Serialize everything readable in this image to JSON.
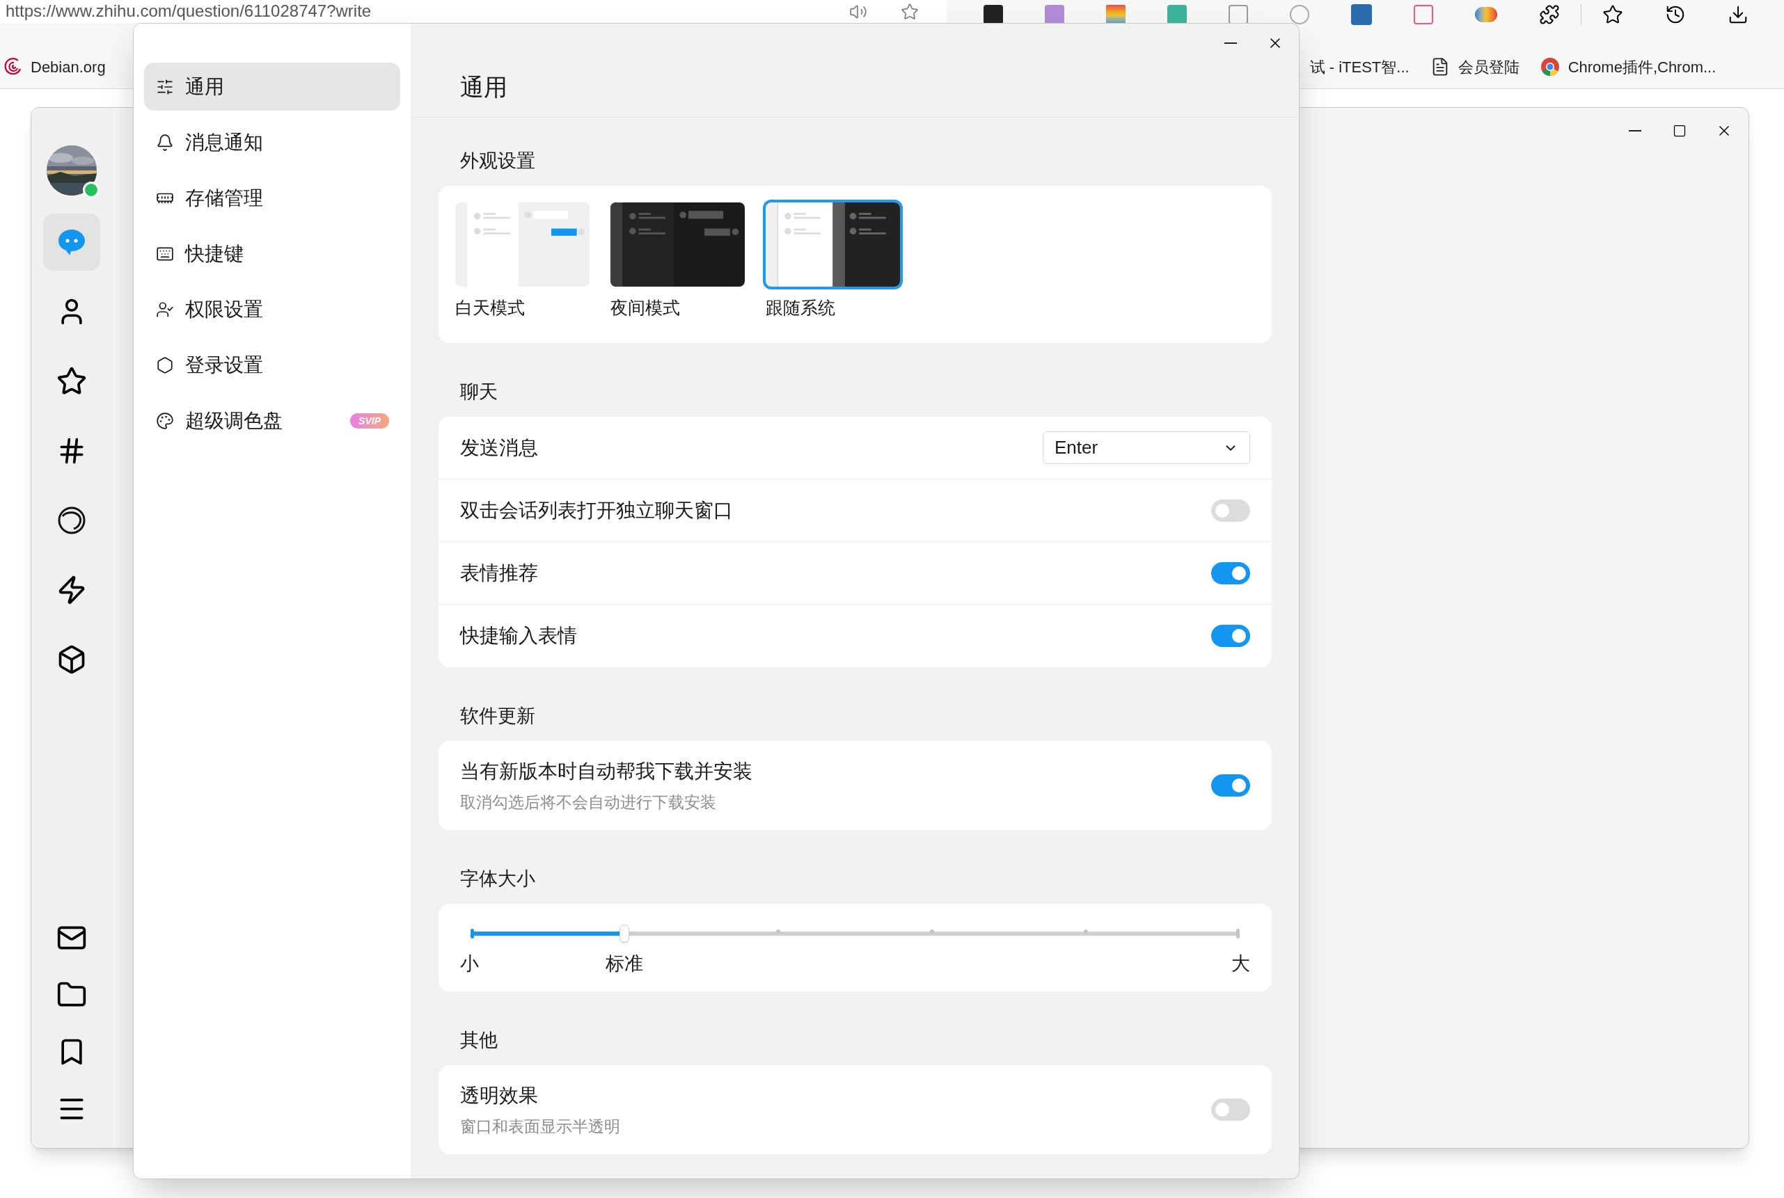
{
  "browser": {
    "url": "https://www.zhihu.com/question/611028747?write",
    "bookmarks": [
      {
        "label": "Debian.org",
        "kind": "debian"
      },
      {
        "label": "试 - iTEST智...",
        "kind": "none"
      },
      {
        "label": "会员登陆",
        "kind": "page"
      },
      {
        "label": "Chrome插件,Chrom...",
        "kind": "chrome"
      }
    ]
  },
  "main_window": {
    "avatar": {
      "online": true
    },
    "nav_items": [
      {
        "kind": "chat",
        "selected": true
      },
      {
        "kind": "contacts",
        "selected": false
      },
      {
        "kind": "star",
        "selected": false
      },
      {
        "kind": "channel",
        "selected": false
      },
      {
        "kind": "circle",
        "selected": false
      },
      {
        "kind": "game",
        "selected": false
      },
      {
        "kind": "box",
        "selected": false
      }
    ],
    "bottom_items": [
      {
        "kind": "mail"
      },
      {
        "kind": "folder"
      },
      {
        "kind": "bookmark"
      },
      {
        "kind": "menu"
      }
    ]
  },
  "settings": {
    "sidebar": [
      {
        "label": "通用",
        "kind": "sliders",
        "selected": true
      },
      {
        "label": "消息通知",
        "kind": "bell",
        "selected": false
      },
      {
        "label": "存储管理",
        "kind": "storage",
        "selected": false
      },
      {
        "label": "快捷键",
        "kind": "keyboard",
        "selected": false
      },
      {
        "label": "权限设置",
        "kind": "permission",
        "selected": false
      },
      {
        "label": "登录设置",
        "kind": "login",
        "selected": false
      },
      {
        "label": "超级调色盘",
        "kind": "palette",
        "selected": false,
        "badge": "SVIP"
      }
    ],
    "title": "通用",
    "appearance": {
      "heading": "外观设置",
      "themes": [
        {
          "label": "白天模式",
          "kind": "light",
          "selected": false
        },
        {
          "label": "夜间模式",
          "kind": "dark",
          "selected": false
        },
        {
          "label": "跟随系统",
          "kind": "system",
          "selected": true
        }
      ]
    },
    "chat": {
      "heading": "聊天",
      "rows": [
        {
          "kind": "select",
          "label": "发送消息",
          "value": "Enter"
        },
        {
          "kind": "toggle",
          "label": "双击会话列表打开独立聊天窗口",
          "on": false
        },
        {
          "kind": "toggle",
          "label": "表情推荐",
          "on": true
        },
        {
          "kind": "toggle",
          "label": "快捷输入表情",
          "on": true
        }
      ]
    },
    "update": {
      "heading": "软件更新",
      "rows": [
        {
          "kind": "toggle",
          "label": "当有新版本时自动帮我下载并安装",
          "description": "取消勾选后将不会自动进行下载安装",
          "on": true
        }
      ]
    },
    "font_size": {
      "heading": "字体大小",
      "level": 0.2,
      "min_label": "小",
      "mid_label": "标准",
      "max_label": "大"
    },
    "other": {
      "heading": "其他",
      "rows": [
        {
          "kind": "toggle",
          "label": "透明效果",
          "description": "窗口和表面显示半透明",
          "on": false
        }
      ]
    }
  }
}
